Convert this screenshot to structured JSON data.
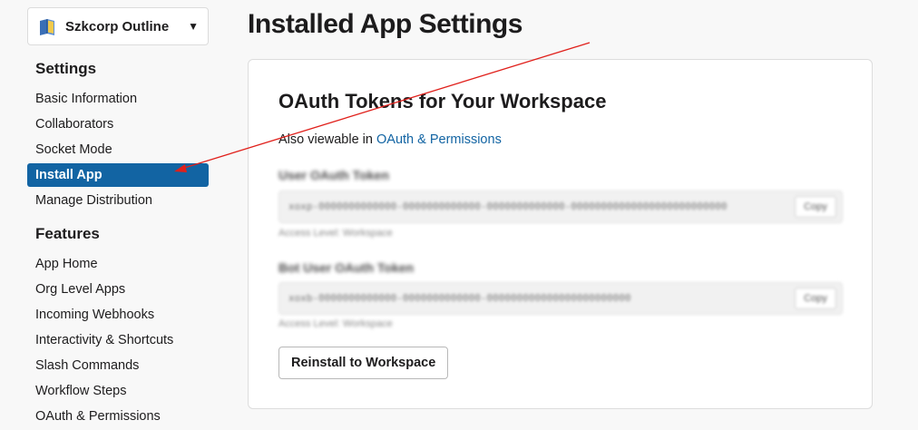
{
  "workspace": {
    "name": "Szkcorp Outline"
  },
  "sidebar": {
    "settings_title": "Settings",
    "settings_items": [
      {
        "label": "Basic Information"
      },
      {
        "label": "Collaborators"
      },
      {
        "label": "Socket Mode"
      },
      {
        "label": "Install App",
        "active": true
      },
      {
        "label": "Manage Distribution"
      }
    ],
    "features_title": "Features",
    "features_items": [
      {
        "label": "App Home"
      },
      {
        "label": "Org Level Apps"
      },
      {
        "label": "Incoming Webhooks"
      },
      {
        "label": "Interactivity & Shortcuts"
      },
      {
        "label": "Slash Commands"
      },
      {
        "label": "Workflow Steps"
      },
      {
        "label": "OAuth & Permissions"
      }
    ]
  },
  "main": {
    "title": "Installed App Settings",
    "card": {
      "title": "OAuth Tokens for Your Workspace",
      "also_prefix": "Also viewable in",
      "also_link": "OAuth & Permissions",
      "user_token": {
        "label": "User OAuth Token",
        "value": "xoxp-0000000000000-0000000000000-0000000000000-00000000000000000000000000",
        "copy_label": "Copy",
        "note": "Access Level: Workspace"
      },
      "bot_token": {
        "label": "Bot User OAuth Token",
        "value": "xoxb-0000000000000-0000000000000-000000000000000000000000",
        "copy_label": "Copy",
        "note": "Access Level: Workspace"
      },
      "reinstall_label": "Reinstall to Workspace"
    }
  },
  "colors": {
    "accent": "#1264a3",
    "annotation_arrow": "#e0201b"
  },
  "icons": {
    "workspace": "book-icon",
    "caret": "caret-down-icon"
  }
}
